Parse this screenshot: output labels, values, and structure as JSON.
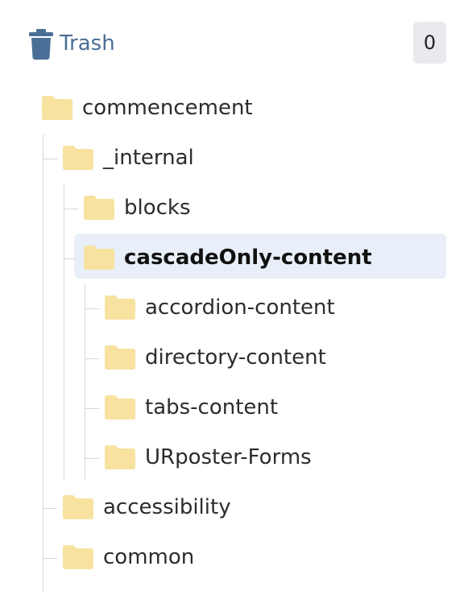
{
  "trash": {
    "label": "Trash",
    "count": "0",
    "icon": "trash-icon",
    "color": "#4a6f96"
  },
  "tree": {
    "folder_color": "#f7e2a0",
    "items": [
      {
        "label": "commencement",
        "icon": "folder-icon"
      },
      {
        "label": "_internal",
        "icon": "folder-icon"
      },
      {
        "label": "blocks",
        "icon": "folder-icon"
      },
      {
        "label": "cascadeOnly-content",
        "icon": "folder-icon",
        "selected": true
      },
      {
        "label": "accordion-content",
        "icon": "folder-icon"
      },
      {
        "label": "directory-content",
        "icon": "folder-icon"
      },
      {
        "label": "tabs-content",
        "icon": "folder-icon"
      },
      {
        "label": "URposter-Forms",
        "icon": "folder-icon"
      },
      {
        "label": "accessibility",
        "icon": "folder-icon"
      },
      {
        "label": "common",
        "icon": "folder-icon"
      }
    ]
  }
}
